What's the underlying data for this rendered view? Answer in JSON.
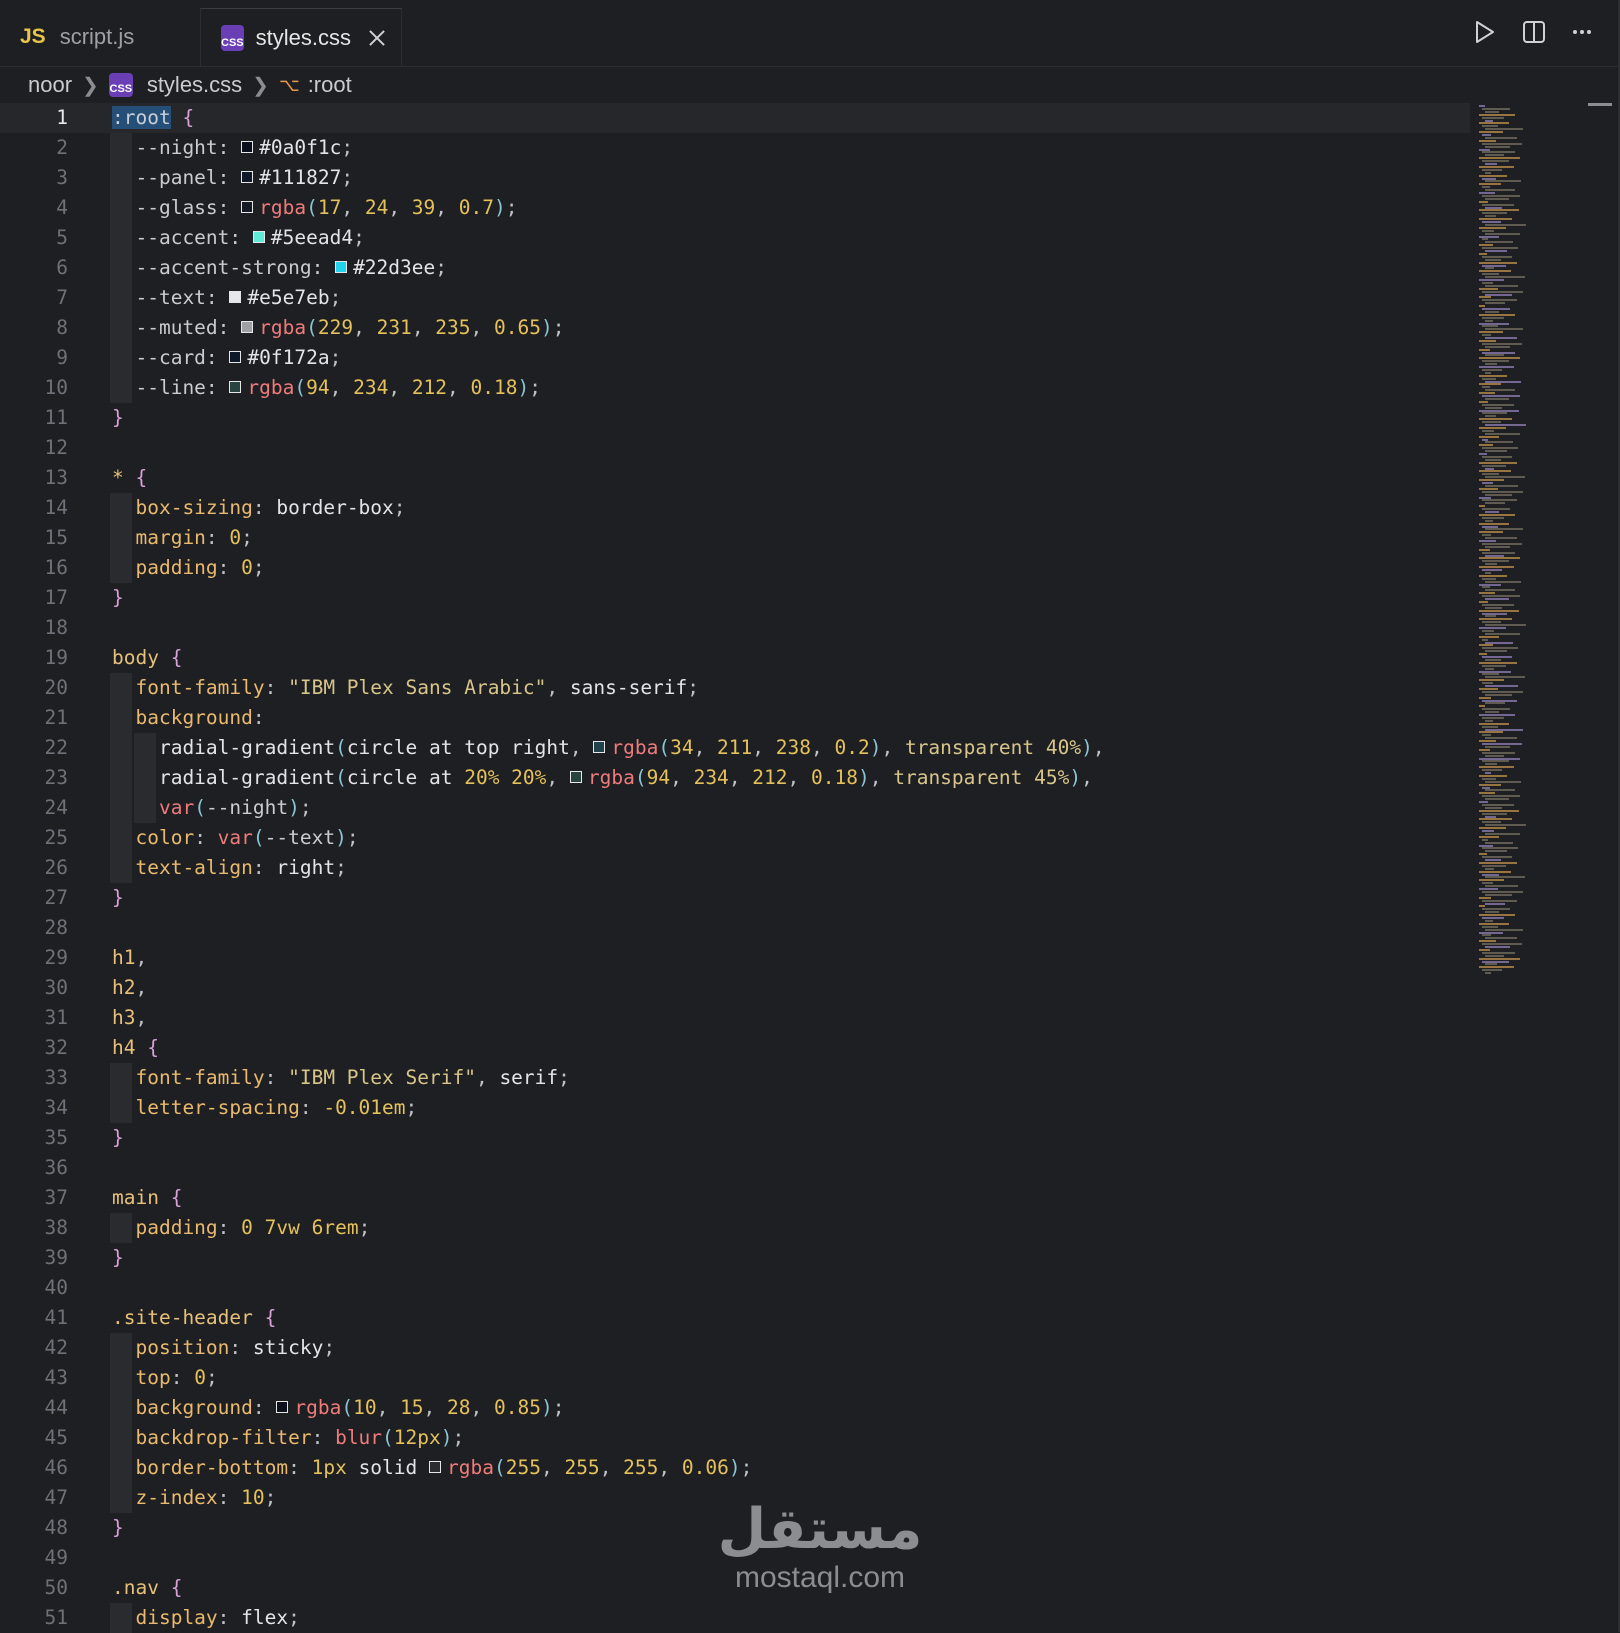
{
  "tabs": [
    {
      "icon": "JS",
      "label": "script.js",
      "active": false
    },
    {
      "icon": "CSS",
      "label": "styles.css",
      "active": true
    }
  ],
  "breadcrumb": {
    "folder": "noor",
    "file": "styles.css",
    "symbol": ":root"
  },
  "editor": {
    "lines": [
      {
        "n": "1",
        "tokens": [
          [
            "sel-root",
            ":root"
          ],
          [
            "",
            " "
          ],
          [
            "brace",
            "{"
          ]
        ]
      },
      {
        "n": "2",
        "tokens": [
          [
            "var",
            "  --night: "
          ],
          [
            "sw",
            "#0a0f1c"
          ],
          [
            "val",
            "#0a0f1c"
          ],
          [
            "punc",
            ";"
          ]
        ]
      },
      {
        "n": "3",
        "tokens": [
          [
            "var",
            "  --panel: "
          ],
          [
            "sw",
            "#111827"
          ],
          [
            "val",
            "#111827"
          ],
          [
            "punc",
            ";"
          ]
        ]
      },
      {
        "n": "4",
        "tokens": [
          [
            "var",
            "  --glass: "
          ],
          [
            "sw",
            "rgba(17,24,39,0.7)"
          ],
          [
            "fn",
            "rgba"
          ],
          [
            "paren",
            "("
          ],
          [
            "num",
            "17"
          ],
          [
            "punc",
            ", "
          ],
          [
            "num",
            "24"
          ],
          [
            "punc",
            ", "
          ],
          [
            "num",
            "39"
          ],
          [
            "punc",
            ", "
          ],
          [
            "num",
            "0.7"
          ],
          [
            "paren",
            ")"
          ],
          [
            "punc",
            ";"
          ]
        ]
      },
      {
        "n": "5",
        "tokens": [
          [
            "var",
            "  --accent: "
          ],
          [
            "sw",
            "#5eead4"
          ],
          [
            "val",
            "#5eead4"
          ],
          [
            "punc",
            ";"
          ]
        ]
      },
      {
        "n": "6",
        "tokens": [
          [
            "var",
            "  --accent-strong: "
          ],
          [
            "sw",
            "#22d3ee"
          ],
          [
            "val",
            "#22d3ee"
          ],
          [
            "punc",
            ";"
          ]
        ]
      },
      {
        "n": "7",
        "tokens": [
          [
            "var",
            "  --text: "
          ],
          [
            "sw",
            "#e5e7eb"
          ],
          [
            "val",
            "#e5e7eb"
          ],
          [
            "punc",
            ";"
          ]
        ]
      },
      {
        "n": "8",
        "tokens": [
          [
            "var",
            "  --muted: "
          ],
          [
            "sw",
            "rgba(229,231,235,0.65)"
          ],
          [
            "fn",
            "rgba"
          ],
          [
            "paren",
            "("
          ],
          [
            "num",
            "229"
          ],
          [
            "punc",
            ", "
          ],
          [
            "num",
            "231"
          ],
          [
            "punc",
            ", "
          ],
          [
            "num",
            "235"
          ],
          [
            "punc",
            ", "
          ],
          [
            "num",
            "0.65"
          ],
          [
            "paren",
            ")"
          ],
          [
            "punc",
            ";"
          ]
        ]
      },
      {
        "n": "9",
        "tokens": [
          [
            "var",
            "  --card: "
          ],
          [
            "sw",
            "#0f172a"
          ],
          [
            "val",
            "#0f172a"
          ],
          [
            "punc",
            ";"
          ]
        ]
      },
      {
        "n": "10",
        "tokens": [
          [
            "var",
            "  --line: "
          ],
          [
            "sw",
            "rgba(94,234,212,0.18)"
          ],
          [
            "fn",
            "rgba"
          ],
          [
            "paren",
            "("
          ],
          [
            "num",
            "94"
          ],
          [
            "punc",
            ", "
          ],
          [
            "num",
            "234"
          ],
          [
            "punc",
            ", "
          ],
          [
            "num",
            "212"
          ],
          [
            "punc",
            ", "
          ],
          [
            "num",
            "0.18"
          ],
          [
            "paren",
            ")"
          ],
          [
            "punc",
            ";"
          ]
        ]
      },
      {
        "n": "11",
        "tokens": [
          [
            "brace",
            "}"
          ]
        ]
      },
      {
        "n": "12",
        "tokens": []
      },
      {
        "n": "13",
        "tokens": [
          [
            "sel",
            "*"
          ],
          [
            "",
            " "
          ],
          [
            "brace",
            "{"
          ]
        ]
      },
      {
        "n": "14",
        "tokens": [
          [
            "prop",
            "  box-sizing"
          ],
          [
            "punc",
            ": "
          ],
          [
            "val",
            "border-box"
          ],
          [
            "punc",
            ";"
          ]
        ]
      },
      {
        "n": "15",
        "tokens": [
          [
            "prop",
            "  margin"
          ],
          [
            "punc",
            ": "
          ],
          [
            "num",
            "0"
          ],
          [
            "punc",
            ";"
          ]
        ]
      },
      {
        "n": "16",
        "tokens": [
          [
            "prop",
            "  padding"
          ],
          [
            "punc",
            ": "
          ],
          [
            "num",
            "0"
          ],
          [
            "punc",
            ";"
          ]
        ]
      },
      {
        "n": "17",
        "tokens": [
          [
            "brace",
            "}"
          ]
        ]
      },
      {
        "n": "18",
        "tokens": []
      },
      {
        "n": "19",
        "tokens": [
          [
            "sel",
            "body"
          ],
          [
            "",
            " "
          ],
          [
            "brace",
            "{"
          ]
        ]
      },
      {
        "n": "20",
        "tokens": [
          [
            "prop",
            "  font-family"
          ],
          [
            "punc",
            ": "
          ],
          [
            "str",
            "\"IBM Plex Sans Arabic\""
          ],
          [
            "punc",
            ", "
          ],
          [
            "val",
            "sans-serif"
          ],
          [
            "punc",
            ";"
          ]
        ]
      },
      {
        "n": "21",
        "tokens": [
          [
            "prop",
            "  background"
          ],
          [
            "punc",
            ":"
          ]
        ]
      },
      {
        "n": "22",
        "tokens": [
          [
            "val",
            "    radial-gradient"
          ],
          [
            "paren",
            "("
          ],
          [
            "val",
            "circle at top right"
          ],
          [
            "punc",
            ", "
          ],
          [
            "sw",
            "rgba(34,211,238,0.2)"
          ],
          [
            "fn",
            "rgba"
          ],
          [
            "paren",
            "("
          ],
          [
            "num",
            "34"
          ],
          [
            "punc",
            ", "
          ],
          [
            "num",
            "211"
          ],
          [
            "punc",
            ", "
          ],
          [
            "num",
            "238"
          ],
          [
            "punc",
            ", "
          ],
          [
            "num",
            "0.2"
          ],
          [
            "paren",
            ")"
          ],
          [
            "punc",
            ", "
          ],
          [
            "str",
            "transparent 40%"
          ],
          [
            "paren",
            ")"
          ],
          [
            "punc",
            ","
          ]
        ]
      },
      {
        "n": "23",
        "tokens": [
          [
            "val",
            "    radial-gradient"
          ],
          [
            "paren",
            "("
          ],
          [
            "val",
            "circle at "
          ],
          [
            "num",
            "20% 20%"
          ],
          [
            "punc",
            ", "
          ],
          [
            "sw",
            "rgba(94,234,212,0.18)"
          ],
          [
            "fn",
            "rgba"
          ],
          [
            "paren",
            "("
          ],
          [
            "num",
            "94"
          ],
          [
            "punc",
            ", "
          ],
          [
            "num",
            "234"
          ],
          [
            "punc",
            ", "
          ],
          [
            "num",
            "212"
          ],
          [
            "punc",
            ", "
          ],
          [
            "num",
            "0.18"
          ],
          [
            "paren",
            ")"
          ],
          [
            "punc",
            ", "
          ],
          [
            "str",
            "transparent 45%"
          ],
          [
            "paren",
            ")"
          ],
          [
            "punc",
            ","
          ]
        ]
      },
      {
        "n": "24",
        "tokens": [
          [
            "fn",
            "    var"
          ],
          [
            "paren",
            "("
          ],
          [
            "var",
            "--night"
          ],
          [
            "paren",
            ")"
          ],
          [
            "punc",
            ";"
          ]
        ]
      },
      {
        "n": "25",
        "tokens": [
          [
            "prop",
            "  color"
          ],
          [
            "punc",
            ": "
          ],
          [
            "fn",
            "var"
          ],
          [
            "paren",
            "("
          ],
          [
            "var",
            "--text"
          ],
          [
            "paren",
            ")"
          ],
          [
            "punc",
            ";"
          ]
        ]
      },
      {
        "n": "26",
        "tokens": [
          [
            "prop",
            "  text-align"
          ],
          [
            "punc",
            ": "
          ],
          [
            "val",
            "right"
          ],
          [
            "punc",
            ";"
          ]
        ]
      },
      {
        "n": "27",
        "tokens": [
          [
            "brace",
            "}"
          ]
        ]
      },
      {
        "n": "28",
        "tokens": []
      },
      {
        "n": "29",
        "tokens": [
          [
            "sel",
            "h1"
          ],
          [
            "punc",
            ","
          ]
        ]
      },
      {
        "n": "30",
        "tokens": [
          [
            "sel",
            "h2"
          ],
          [
            "punc",
            ","
          ]
        ]
      },
      {
        "n": "31",
        "tokens": [
          [
            "sel",
            "h3"
          ],
          [
            "punc",
            ","
          ]
        ]
      },
      {
        "n": "32",
        "tokens": [
          [
            "sel",
            "h4"
          ],
          [
            "",
            " "
          ],
          [
            "brace",
            "{"
          ]
        ]
      },
      {
        "n": "33",
        "tokens": [
          [
            "prop",
            "  font-family"
          ],
          [
            "punc",
            ": "
          ],
          [
            "str",
            "\"IBM Plex Serif\""
          ],
          [
            "punc",
            ", "
          ],
          [
            "val",
            "serif"
          ],
          [
            "punc",
            ";"
          ]
        ]
      },
      {
        "n": "34",
        "tokens": [
          [
            "prop",
            "  letter-spacing"
          ],
          [
            "punc",
            ": "
          ],
          [
            "num",
            "-0.01em"
          ],
          [
            "punc",
            ";"
          ]
        ]
      },
      {
        "n": "35",
        "tokens": [
          [
            "brace",
            "}"
          ]
        ]
      },
      {
        "n": "36",
        "tokens": []
      },
      {
        "n": "37",
        "tokens": [
          [
            "sel",
            "main"
          ],
          [
            "",
            " "
          ],
          [
            "brace",
            "{"
          ]
        ]
      },
      {
        "n": "38",
        "tokens": [
          [
            "prop",
            "  padding"
          ],
          [
            "punc",
            ": "
          ],
          [
            "num",
            "0 7vw 6rem"
          ],
          [
            "punc",
            ";"
          ]
        ]
      },
      {
        "n": "39",
        "tokens": [
          [
            "brace",
            "}"
          ]
        ]
      },
      {
        "n": "40",
        "tokens": []
      },
      {
        "n": "41",
        "tokens": [
          [
            "sel",
            ".site-header"
          ],
          [
            "",
            " "
          ],
          [
            "brace",
            "{"
          ]
        ]
      },
      {
        "n": "42",
        "tokens": [
          [
            "prop",
            "  position"
          ],
          [
            "punc",
            ": "
          ],
          [
            "val",
            "sticky"
          ],
          [
            "punc",
            ";"
          ]
        ]
      },
      {
        "n": "43",
        "tokens": [
          [
            "prop",
            "  top"
          ],
          [
            "punc",
            ": "
          ],
          [
            "num",
            "0"
          ],
          [
            "punc",
            ";"
          ]
        ]
      },
      {
        "n": "44",
        "tokens": [
          [
            "prop",
            "  background"
          ],
          [
            "punc",
            ": "
          ],
          [
            "sw",
            "rgba(10,15,28,0.85)"
          ],
          [
            "fn",
            "rgba"
          ],
          [
            "paren",
            "("
          ],
          [
            "num",
            "10"
          ],
          [
            "punc",
            ", "
          ],
          [
            "num",
            "15"
          ],
          [
            "punc",
            ", "
          ],
          [
            "num",
            "28"
          ],
          [
            "punc",
            ", "
          ],
          [
            "num",
            "0.85"
          ],
          [
            "paren",
            ")"
          ],
          [
            "punc",
            ";"
          ]
        ]
      },
      {
        "n": "45",
        "tokens": [
          [
            "prop",
            "  backdrop-filter"
          ],
          [
            "punc",
            ": "
          ],
          [
            "fn",
            "blur"
          ],
          [
            "paren",
            "("
          ],
          [
            "num",
            "12px"
          ],
          [
            "paren",
            ")"
          ],
          [
            "punc",
            ";"
          ]
        ]
      },
      {
        "n": "46",
        "tokens": [
          [
            "prop",
            "  border-bottom"
          ],
          [
            "punc",
            ": "
          ],
          [
            "num",
            "1px"
          ],
          [
            "val",
            " solid "
          ],
          [
            "sw",
            "rgba(255,255,255,0.06)"
          ],
          [
            "fn",
            "rgba"
          ],
          [
            "paren",
            "("
          ],
          [
            "num",
            "255"
          ],
          [
            "punc",
            ", "
          ],
          [
            "num",
            "255"
          ],
          [
            "punc",
            ", "
          ],
          [
            "num",
            "255"
          ],
          [
            "punc",
            ", "
          ],
          [
            "num",
            "0.06"
          ],
          [
            "paren",
            ")"
          ],
          [
            "punc",
            ";"
          ]
        ]
      },
      {
        "n": "47",
        "tokens": [
          [
            "prop",
            "  z-index"
          ],
          [
            "punc",
            ": "
          ],
          [
            "num",
            "10"
          ],
          [
            "punc",
            ";"
          ]
        ]
      },
      {
        "n": "48",
        "tokens": [
          [
            "brace",
            "}"
          ]
        ]
      },
      {
        "n": "49",
        "tokens": []
      },
      {
        "n": "50",
        "tokens": [
          [
            "sel",
            ".nav"
          ],
          [
            "",
            " "
          ],
          [
            "brace",
            "{"
          ]
        ]
      },
      {
        "n": "51",
        "tokens": [
          [
            "prop",
            "  display"
          ],
          [
            "punc",
            ": "
          ],
          [
            "val",
            "flex"
          ],
          [
            "punc",
            ";"
          ]
        ]
      }
    ],
    "current_line": "1"
  },
  "watermark": {
    "arabic": "مستقل",
    "latin": "mostaql.com"
  },
  "icons": [
    "run-icon",
    "split-editor-icon",
    "more-actions-icon",
    "close-icon",
    "chevron-right-icon",
    "symbol-icon",
    "css-file-icon",
    "js-file-icon"
  ],
  "colors": {
    "background": "#1e1f22",
    "current_line": "#26272b",
    "selection": "#264f78",
    "css_badge": "#6a3fb5",
    "js_badge": "#e8c44b"
  }
}
